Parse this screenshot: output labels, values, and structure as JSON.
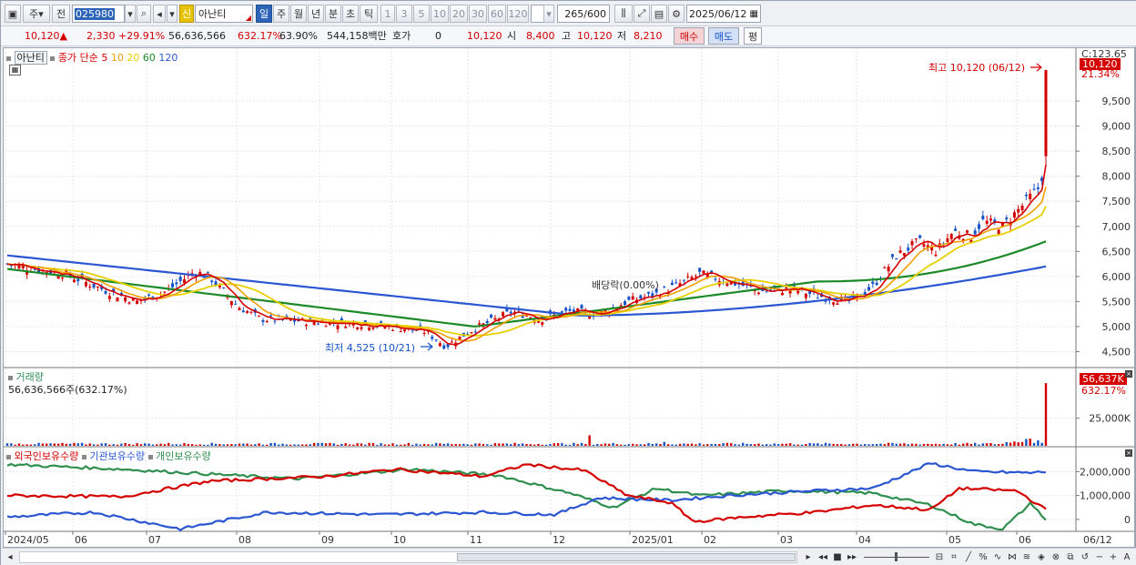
{
  "toolbar": {
    "market": "주",
    "prev": "전",
    "code": "025980",
    "badge_new": "신",
    "stock_name": "아난티",
    "periods": [
      "일",
      "주",
      "월",
      "년",
      "분",
      "초",
      "틱"
    ],
    "active_period": "일",
    "intervals": [
      "1",
      "3",
      "5",
      "10",
      "20",
      "30",
      "60",
      "120"
    ],
    "count": "265",
    "count_total": "/600",
    "date": "2025/06/12"
  },
  "quote": {
    "price": "10,120",
    "change": "2,330",
    "change_pct": "+29.91%",
    "volume": "56,636,566",
    "vol_ratio": "632.17%",
    "turnover_pct": "63.90%",
    "amount": "544,158백만",
    "hoga_label": "호가",
    "hoga_value": "0",
    "hoga_price": "10,120",
    "open_label": "시",
    "open": "8,400",
    "high_label": "고",
    "high": "10,120",
    "low_label": "저",
    "low": "8,210",
    "buy_label": "매수",
    "sell_label": "매도",
    "flat_label": "평"
  },
  "price_panel": {
    "name_tag": "아난티",
    "legend_title": "종가 단순",
    "ma_periods": [
      "5",
      "10",
      "20",
      "60",
      "120"
    ],
    "ma_colors": [
      "#d40000",
      "#f0a000",
      "#e6d000",
      "#1c8a28",
      "#2b56d1"
    ],
    "y_ticks": [
      "9,500",
      "9,000",
      "8,500",
      "8,000",
      "7,500",
      "7,000",
      "6,500",
      "6,000",
      "5,500",
      "5,000",
      "4,500"
    ],
    "top_label": "C:123.65",
    "last_price_tag": "10,120",
    "last_pct_tag": "21.34%",
    "high_note": "최고 10,120 (06/12)",
    "low_note": "최저 4,525 (10/21)",
    "ex_dividend_note": "배당락(0.00%)"
  },
  "volume_panel": {
    "title": "거래량",
    "subtitle": "56,636,566주(632.17%)",
    "tag_value": "56,637K",
    "tag_pct": "632.17%",
    "y_tick": "25,000K"
  },
  "holdings_panel": {
    "series": [
      "외국인보유수량",
      "기관보유수량",
      "개인보유수량"
    ],
    "colors": [
      "#d40000",
      "#2b56d1",
      "#2f8f4e"
    ],
    "y_ticks": [
      "2,000,000",
      "1,000,000",
      "0"
    ]
  },
  "x_axis": [
    "2024/05",
    "06",
    "07",
    "08",
    "09",
    "10",
    "11",
    "12",
    "2025/01",
    "02",
    "03",
    "04",
    "05",
    "06",
    "06/12"
  ]
}
